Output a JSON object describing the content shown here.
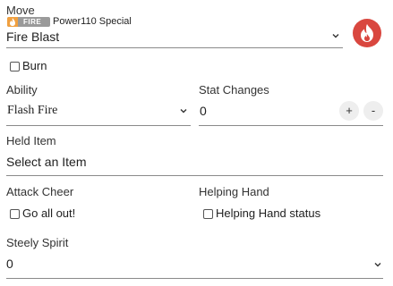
{
  "move": {
    "label": "Move",
    "type_badge": "FIRE",
    "meta": "Power110 Special",
    "value": "Fire Blast",
    "type_icon": "fire-icon",
    "type_color": "#d9473f"
  },
  "burn": {
    "label": "Burn",
    "checked": false
  },
  "ability": {
    "label": "Ability",
    "value": "Flash Fire"
  },
  "stat_changes": {
    "label": "Stat Changes",
    "value": "0",
    "plus": "+",
    "minus": "-"
  },
  "held_item": {
    "label": "Held Item",
    "placeholder": "Select an Item"
  },
  "attack_cheer": {
    "label": "Attack Cheer",
    "checkbox_label": "Go all out!",
    "checked": false
  },
  "helping_hand": {
    "label": "Helping Hand",
    "checkbox_label": "Helping Hand status",
    "checked": false
  },
  "steely_spirit": {
    "label": "Steely Spirit",
    "value": "0"
  }
}
